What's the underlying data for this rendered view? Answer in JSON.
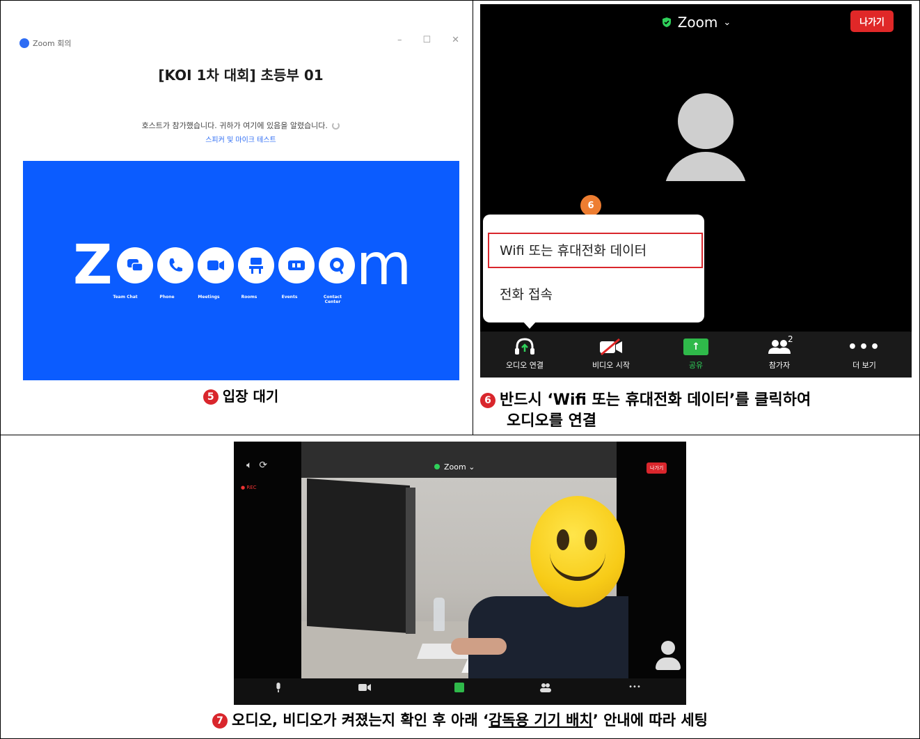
{
  "panel5": {
    "window_title": "Zoom 회의",
    "controls": [
      "–",
      "☐",
      "✕"
    ],
    "meeting_title": "[KOI 1차 대회] 초등부 01",
    "waiting_message": "호스트가 참가했습니다. 귀하가 여기에 있음을 알렸습니다.",
    "test_link": "스피커 및 마이크 테스트",
    "banner_products": [
      "Team Chat",
      "Phone",
      "Meetings",
      "Rooms",
      "Events",
      "Contact\nCenter"
    ],
    "banner_color": "#0b5cff",
    "caption_number": "5",
    "caption": "입장 대기"
  },
  "panel6": {
    "app_name": "Zoom",
    "leave_button": "나가기",
    "step_badge": "6",
    "popup_options": [
      "Wifi 또는 휴대전화 데이터",
      "전화 접속"
    ],
    "toolbar": [
      {
        "label": "오디오 연결",
        "icon": "headphones-icon"
      },
      {
        "label": "비디오 시작",
        "icon": "video-off-icon"
      },
      {
        "label": "공유",
        "icon": "share-icon"
      },
      {
        "label": "참가자",
        "icon": "participants-icon",
        "count": "2"
      },
      {
        "label": "더 보기",
        "icon": "more-icon"
      }
    ],
    "caption_number": "6",
    "caption_line1": "반드시 ‘Wifi 또는 휴대전화 데이터’를 클릭하여",
    "caption_line2": "오디오를 연결"
  },
  "panel7": {
    "app_name": "Zoom",
    "leave_button": "나가기",
    "rec_label": "● REC",
    "caption_number": "7",
    "caption_before": "오디오, 비디오가 켜졌는지 확인 후 아래 ‘",
    "caption_underlined": "감독용 기기 배치",
    "caption_after": "’ 안내에 따라 세팅"
  },
  "colors": {
    "accent_red": "#d9262c",
    "badge_orange": "#ed7d31",
    "share_green": "#2fb94a"
  }
}
